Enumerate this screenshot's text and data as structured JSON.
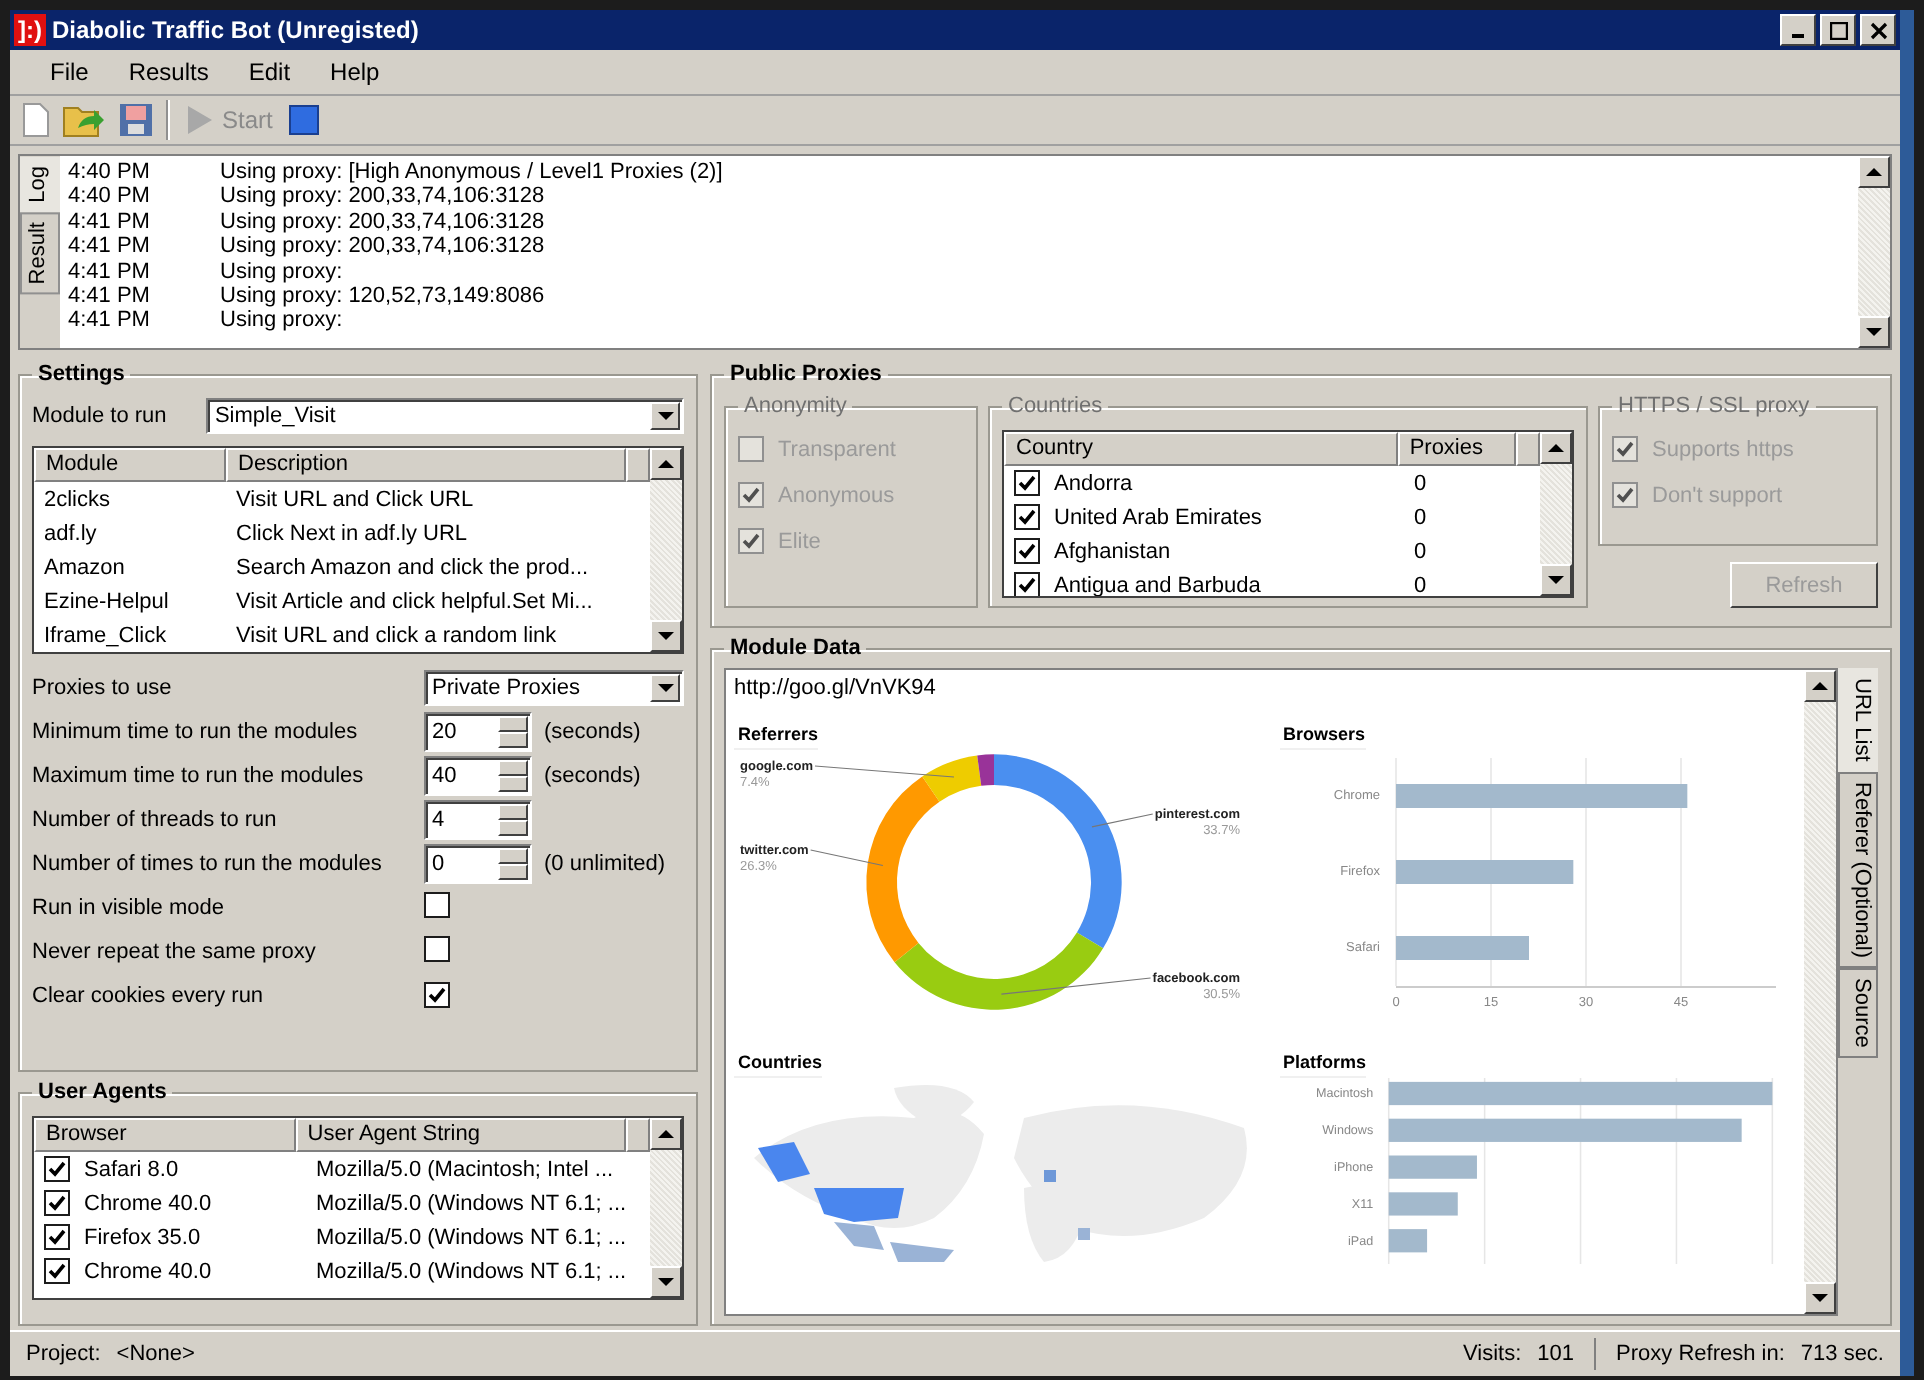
{
  "window": {
    "icon_text": "]:)",
    "title": "Diabolic Traffic Bot (Unregisted)"
  },
  "menu": [
    "File",
    "Results",
    "Edit",
    "Help"
  ],
  "toolbar": {
    "start": {
      "label": "Start",
      "disabled": true
    }
  },
  "log": {
    "tabs": [
      {
        "label": "Log",
        "selected": true
      },
      {
        "label": "Result",
        "selected": false
      }
    ],
    "lines": [
      {
        "time": "4:40 PM",
        "message": "Using proxy: [High Anonymous / Level1 Proxies (2)]"
      },
      {
        "time": "4:40 PM",
        "message": "Using proxy: 200,33,74,106:3128"
      },
      {
        "time": "4:41 PM",
        "message": "Using proxy: 200,33,74,106:3128"
      },
      {
        "time": "4:41 PM",
        "message": "Using proxy: 200,33,74,106:3128"
      },
      {
        "time": "4:41 PM",
        "message": "Using proxy:"
      },
      {
        "time": "4:41 PM",
        "message": "Using proxy: 120,52,73,149:8086"
      },
      {
        "time": "4:41 PM",
        "message": "Using proxy:"
      }
    ]
  },
  "settings": {
    "title": "Settings",
    "module_label": "Module to run",
    "module_value": "Simple_Visit",
    "module_table": {
      "columns": [
        "Module",
        "Description"
      ],
      "rows": [
        [
          "2clicks",
          "Visit URL and Click URL"
        ],
        [
          "adf.ly",
          "Click Next in adf.ly URL"
        ],
        [
          "Amazon",
          "Search Amazon and click the prod..."
        ],
        [
          "Ezine-Helpul",
          "Visit Article and click helpful.Set Mi..."
        ],
        [
          "Iframe_Click",
          "Visit URL and click a random link"
        ]
      ]
    },
    "fields": [
      {
        "kind": "dropdown",
        "label": "Proxies to use",
        "value": "Private Proxies"
      },
      {
        "kind": "spinner",
        "label": "Minimum time to run the modules",
        "value": "20",
        "unit": "(seconds)"
      },
      {
        "kind": "spinner",
        "label": "Maximum time to run the modules",
        "value": "40",
        "unit": "(seconds)"
      },
      {
        "kind": "spinner",
        "label": "Number of threads to run",
        "value": "4"
      },
      {
        "kind": "spinner",
        "label": "Number of times to run the modules",
        "value": "0",
        "unit": "(0 unlimited)"
      },
      {
        "kind": "checkbox",
        "label": "Run in visible mode",
        "checked": false
      },
      {
        "kind": "checkbox",
        "label": "Never repeat the same proxy",
        "checked": false
      },
      {
        "kind": "checkbox",
        "label": "Clear cookies every run",
        "checked": true
      }
    ]
  },
  "user_agents": {
    "title": "User Agents",
    "columns": [
      "Browser",
      "User Agent String"
    ],
    "rows": [
      {
        "browser": "Safari 8.0",
        "string": "Mozilla/5.0 (Macintosh; Intel ...",
        "checked": true
      },
      {
        "browser": "Chrome 40.0",
        "string": "Mozilla/5.0 (Windows NT 6.1; ...",
        "checked": true
      },
      {
        "browser": "Firefox 35.0",
        "string": "Mozilla/5.0 (Windows NT 6.1; ...",
        "checked": true
      },
      {
        "browser": "Chrome 40.0",
        "string": "Mozilla/5.0 (Windows NT 6.1; ...",
        "checked": true
      }
    ]
  },
  "public_proxies": {
    "title": "Public Proxies",
    "anonymity": {
      "title": "Anonymity",
      "disabled": true,
      "options": [
        {
          "label": "Transparent",
          "checked": false
        },
        {
          "label": "Anonymous",
          "checked": true
        },
        {
          "label": "Elite",
          "checked": true
        }
      ]
    },
    "countries": {
      "title": "Countries",
      "columns": [
        "Country",
        "Proxies"
      ],
      "rows": [
        {
          "country": "Andorra",
          "proxies": "0",
          "checked": true
        },
        {
          "country": "United Arab Emirates",
          "proxies": "0",
          "checked": true
        },
        {
          "country": "Afghanistan",
          "proxies": "0",
          "checked": true
        },
        {
          "country": "Antigua and Barbuda",
          "proxies": "0",
          "checked": true
        }
      ]
    },
    "https": {
      "title": "HTTPS / SSL proxy",
      "disabled": true,
      "options": [
        {
          "label": "Supports https",
          "checked": true
        },
        {
          "label": "Don't support",
          "checked": true
        }
      ]
    },
    "refresh": {
      "label": "Refresh",
      "disabled": true
    }
  },
  "module_data": {
    "title": "Module Data",
    "url": "http://goo.gl/VnVK94",
    "tabs": [
      {
        "label": "URL List",
        "selected": true
      },
      {
        "label": "Referer (Optional)",
        "selected": false
      },
      {
        "label": "Source",
        "selected": false
      }
    ],
    "referrers": {
      "title": "Referrers",
      "chart_data": {
        "type": "donut",
        "categories": [
          "pinterest.com",
          "facebook.com",
          "twitter.com",
          "google.com",
          null
        ],
        "values": [
          33.7,
          30.5,
          26.3,
          7.4,
          2.1
        ],
        "colors": [
          "#4a8ff0",
          "#99cc11",
          "#ff9900",
          "#eecc00",
          "#993399"
        ],
        "value_labels": [
          "33.7%",
          "30.5%",
          "26.3%",
          "7.4%",
          null
        ]
      }
    },
    "browsers": {
      "title": "Browsers",
      "chart_data": {
        "type": "bar",
        "orientation": "horizontal",
        "categories": [
          "Chrome",
          "Firefox",
          "Safari"
        ],
        "values": [
          46,
          28,
          21
        ],
        "xlim": [
          0,
          60
        ],
        "xticks": [
          0,
          15,
          30,
          45
        ],
        "grid": true
      }
    },
    "countries": {
      "title": "Countries"
    },
    "platforms": {
      "title": "Platforms",
      "labels": [
        "Macintosh",
        "Windows",
        "iPhone",
        "X11",
        "iPad"
      ]
    }
  },
  "status_bar": {
    "project_label": "Project:",
    "project": "<None>",
    "visits_label": "Visits:",
    "visits": "101",
    "refresh_label": "Proxy Refresh in:",
    "refresh": "713 sec."
  }
}
